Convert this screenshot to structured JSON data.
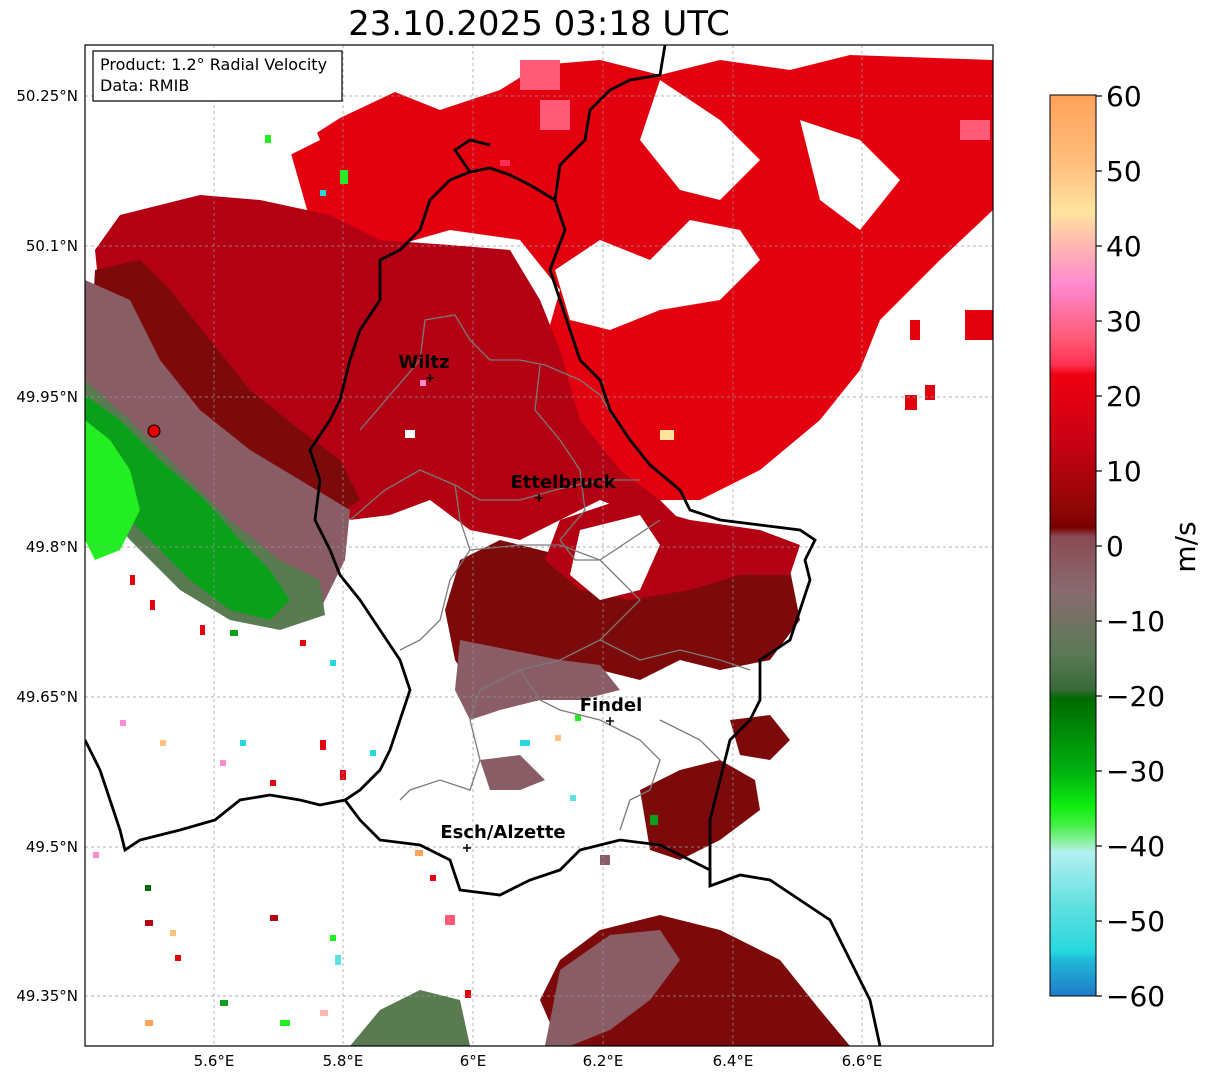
{
  "title": "23.10.2025 03:18 UTC",
  "info": {
    "product": "Product: 1.2° Radial Velocity",
    "data": "Data: RMIB"
  },
  "lat_ticks": [
    "50.25°N",
    "50.1°N",
    "49.95°N",
    "49.8°N",
    "49.65°N",
    "49.5°N",
    "49.35°N"
  ],
  "lon_ticks": [
    "5.6°E",
    "5.8°E",
    "6°E",
    "6.2°E",
    "6.4°E",
    "6.6°E"
  ],
  "cities": [
    {
      "name": "Wiltz"
    },
    {
      "name": "Ettelbruck"
    },
    {
      "name": "Findel"
    },
    {
      "name": "Esch/Alzette"
    }
  ],
  "colorbar": {
    "label": "m/s",
    "ticks": [
      "60",
      "50",
      "40",
      "30",
      "20",
      "10",
      "0",
      "−10",
      "−20",
      "−30",
      "−40",
      "−50",
      "−60"
    ],
    "min": -60,
    "max": 60
  },
  "colors": {
    "strong_receding": "#e3000f",
    "receding": "#b30012",
    "weak_receding": "#7d0a0a",
    "near_zero": "#8a5c66",
    "weak_approaching": "#5a7a52",
    "approaching": "#0aa01a",
    "strong_approaching": "#22ee22",
    "radar_site": "#e00000"
  }
}
